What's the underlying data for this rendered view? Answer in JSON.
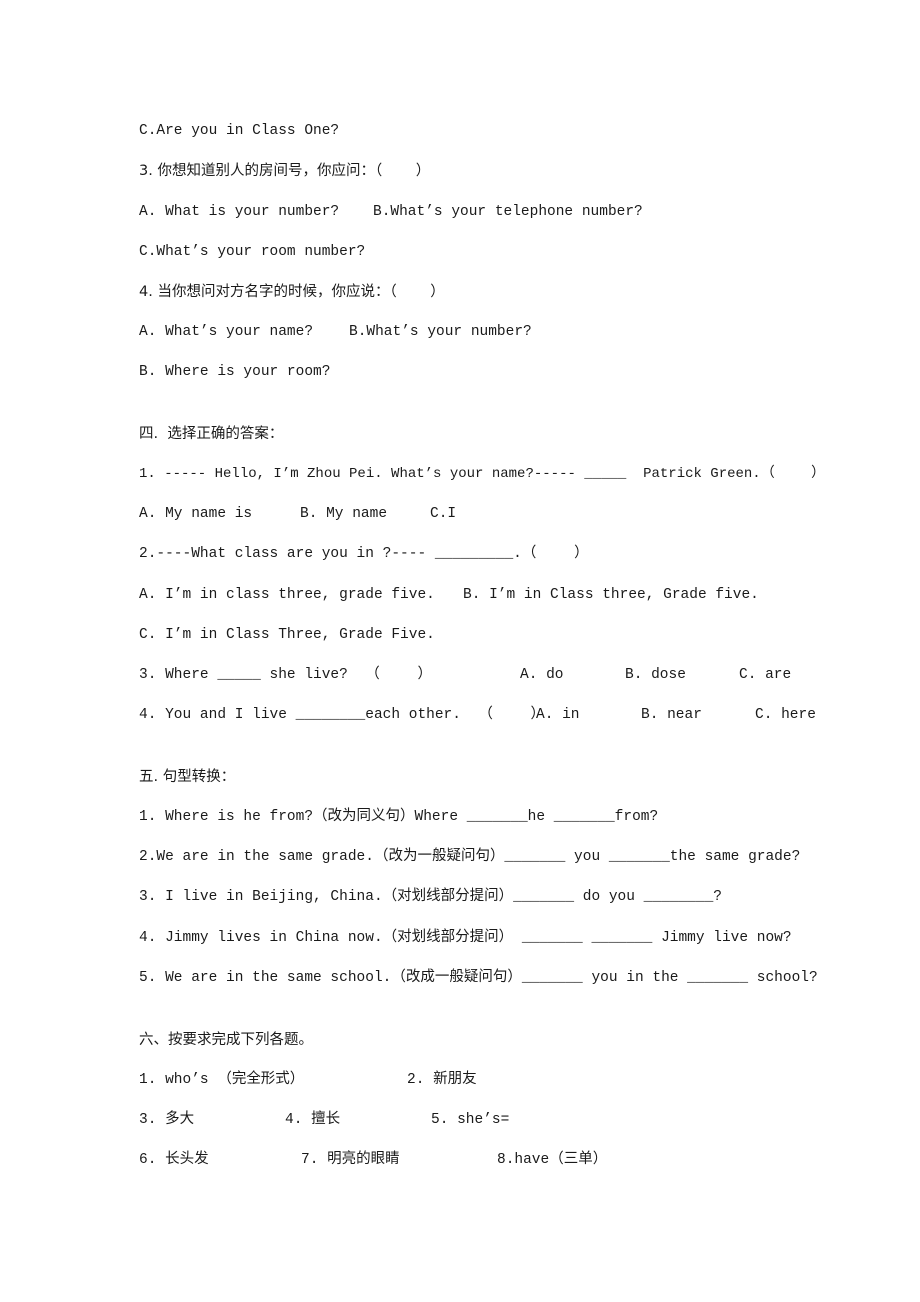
{
  "document": {
    "section_3_continued": {
      "q2_option_c": "C.Are you in Class One?",
      "q3": {
        "prompt": "3. 你想知道别人的房间号，你应问：（　　 ）",
        "option_a": "A. What is your number?",
        "option_b": "B.What’s your telephone number?",
        "option_c": "C.What’s your room number?"
      },
      "q4": {
        "prompt": "4. 当你想问对方名字的时候，你应说：（　　 ）",
        "option_a": "A. What’s your name?",
        "option_b": "B.What’s your number?",
        "option_c": "B. Where is your room?"
      }
    },
    "section_4": {
      "title": "四.  选择正确的答案：",
      "q1": {
        "prompt": "1. ----- Hello, I’m Zhou Pei. What’s your name?----- _____  Patrick Green.（　　 ）",
        "option_a": "A. My name is",
        "option_b": "B. My name",
        "option_c": "C.I"
      },
      "q2": {
        "prompt": "2.----What class are you in ?---- _________.（　　 ）",
        "option_a": "A. I’m in class three, grade five.",
        "option_b": "B. I’m in Class three, Grade five.",
        "option_c": "C. I’m in Class Three, Grade Five."
      },
      "q3": {
        "prompt": "3. Where _____ she live?  （　　 ）",
        "option_a": "A. do",
        "option_b": "B. dose",
        "option_c": "C. are"
      },
      "q4": {
        "prompt": "4. You and I live ________each other.  （　　 ）",
        "option_a": "A. in",
        "option_b": "B. near",
        "option_c": "C. here"
      }
    },
    "section_5": {
      "title": "五. 句型转换：",
      "items": [
        "1. Where is he from?（改为同义句）Where _______he _______from?",
        "2.We are in the same grade.（改为一般疑问句）_______ you _______the same grade?",
        "3. I live in Beijing, China.（对划线部分提问）_______ do you ________?",
        "4. Jimmy lives in China now.（对划线部分提问） _______ _______ Jimmy live now?",
        "5. We are in the same school.（改成一般疑问句）_______ you in the _______ school?"
      ]
    },
    "section_6": {
      "title": "六、按要求完成下列各题。",
      "items": [
        "1. who’s （完全形式）",
        "2. 新朋友",
        "3. 多大",
        "4. 擅长",
        "5. she’s=",
        "6. 长头发",
        "7. 明亮的眼睛",
        "8.have（三单）"
      ]
    }
  }
}
